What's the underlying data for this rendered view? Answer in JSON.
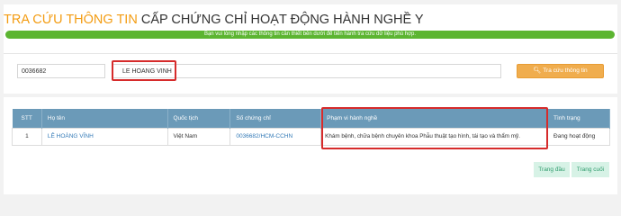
{
  "header": {
    "title_part1": "TRA CỨU THÔNG TIN",
    "title_part2": "CẤP CHỨNG CHỈ HOẠT ĐỘNG HÀNH NGHỀ Y",
    "notice": "Bạn vui lòng nhập các thông tin cần thiết bên dưới để tiến hành tra cứu dữ liệu phù hợp."
  },
  "search": {
    "certificate_value": "0036682",
    "name_value": "LÊ HOÀNG VĨNH",
    "button_label": "Tra cứu thông tin",
    "button_icon": "search-icon"
  },
  "table": {
    "columns": [
      "STT",
      "Họ tên",
      "Quốc tịch",
      "Số chứng chỉ",
      "Phạm vi hành nghề",
      "Tình trạng"
    ],
    "rows": [
      {
        "stt": "1",
        "name": "LÊ HOÀNG VĨNH",
        "nationality": "Việt Nam",
        "certificate": "0036682/HCM-CCHN",
        "scope": "Khám bệnh, chữa bệnh chuyên khoa Phẫu thuật tạo hình, tái tạo và thẩm mỹ.",
        "status": "Đang hoạt động"
      }
    ]
  },
  "pager": {
    "first_label": "Trang đầu",
    "last_label": "Trang cuối"
  },
  "colors": {
    "title_accent": "#f39c12",
    "notice_bar": "#5cb531",
    "search_button": "#f0ad4e",
    "table_header": "#6b9ab8",
    "highlight": "#d62b2b",
    "link": "#337ab7"
  }
}
